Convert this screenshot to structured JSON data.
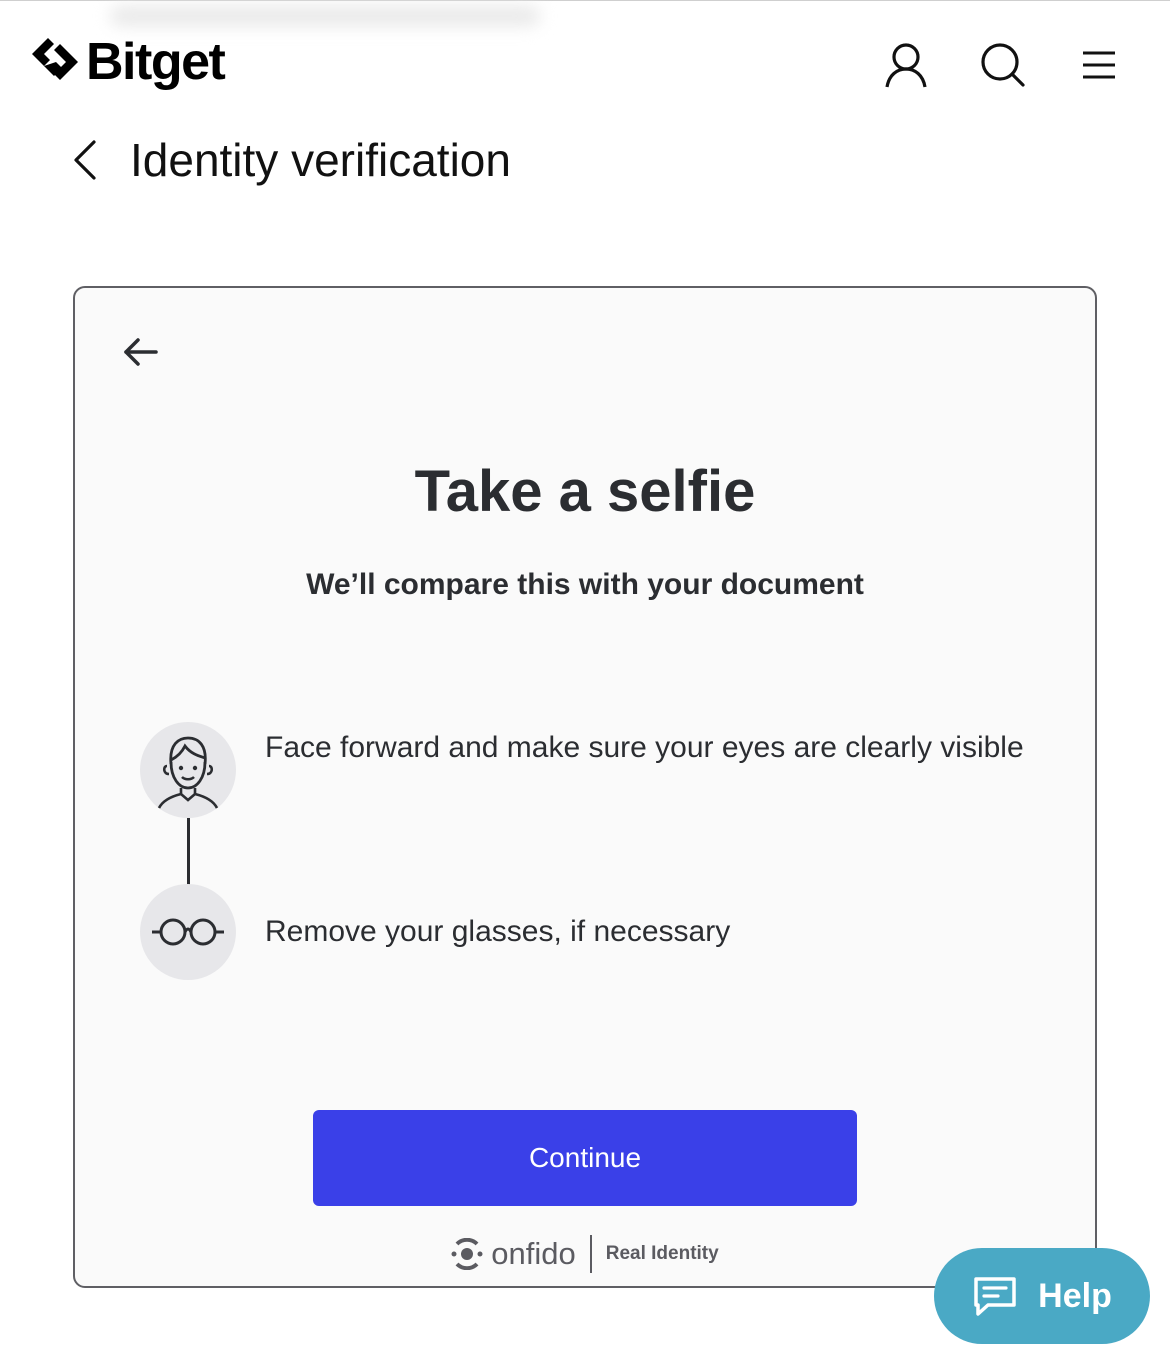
{
  "header": {
    "brand": "Bitget",
    "icons": [
      "user-icon",
      "search-icon",
      "menu-icon"
    ]
  },
  "page": {
    "title": "Identity verification"
  },
  "card": {
    "title": "Take a selfie",
    "subtitle": "We’ll compare this with your document",
    "steps": [
      {
        "icon": "face-icon",
        "text": "Face forward and make sure your eyes are clearly visible"
      },
      {
        "icon": "glasses-icon",
        "text": "Remove your glasses, if necessary"
      }
    ],
    "continue_label": "Continue",
    "footer": {
      "brand": "onfido",
      "tagline": "Real Identity"
    }
  },
  "help": {
    "label": "Help"
  },
  "colors": {
    "primary_button": "#3a40e8",
    "help_button": "#4aa9c5",
    "text_dark": "#2b2d31"
  }
}
